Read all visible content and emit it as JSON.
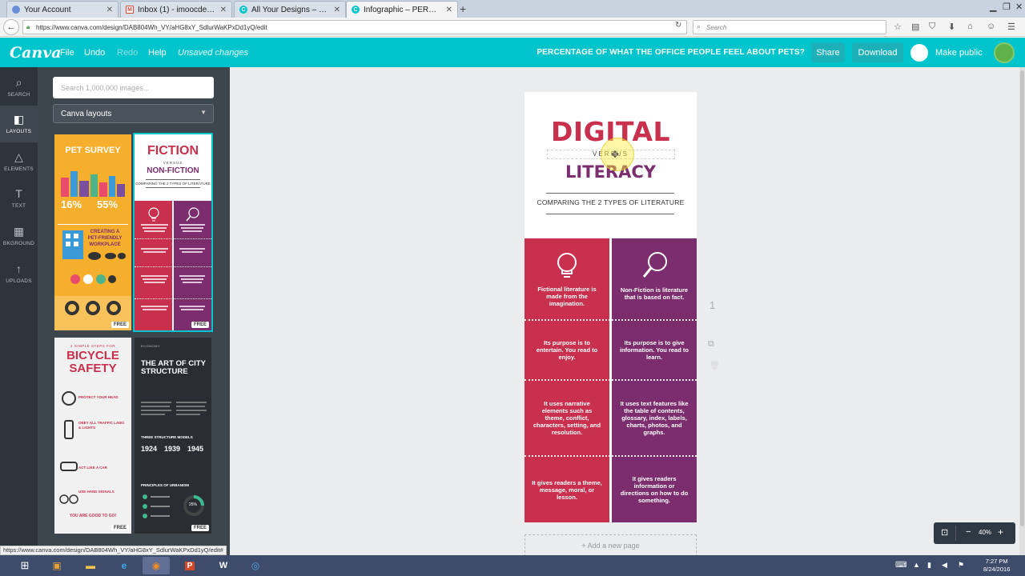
{
  "browser": {
    "tabs": [
      {
        "title": "Your Account",
        "favicon_color": "#6b8fd6"
      },
      {
        "title": "Inbox (1) - imoocdev@gm...",
        "favicon_color": "#d44638"
      },
      {
        "title": "All Your Designs – Canva",
        "favicon_color": "#00c4cc"
      },
      {
        "title": "Infographic – PERCENTAG...",
        "favicon_color": "#00c4cc"
      }
    ],
    "url": "https://www.canva.com/design/DAB804Wh_VY/aHG8xY_SdlurWaKPxDd1yQ/edit",
    "search_placeholder": "Search",
    "status_url": "https://www.canva.com/design/DAB804Wh_VY/aHG8xY_SdlurWaKPxDd1yQ/edit#"
  },
  "header": {
    "logo": "Canva",
    "menu": [
      "File",
      "Undo",
      "Redo",
      "Help"
    ],
    "unsaved": "Unsaved changes",
    "doc_title": "PERCENTAGE OF WHAT THE OFFICE PEOPLE FEEL ABOUT PETS?",
    "share": "Share",
    "download": "Download",
    "make_public": "Make public"
  },
  "tools": [
    {
      "label": "SEARCH",
      "icon": "search-icon"
    },
    {
      "label": "LAYOUTS",
      "icon": "layouts-icon"
    },
    {
      "label": "ELEMENTS",
      "icon": "elements-icon"
    },
    {
      "label": "TEXT",
      "icon": "text-icon"
    },
    {
      "label": "BKGROUND",
      "icon": "background-icon"
    },
    {
      "label": "UPLOADS",
      "icon": "upload-icon"
    }
  ],
  "panel": {
    "search_placeholder": "Search 1,000,000 images...",
    "layout_select": "Canva layouts",
    "free_badge": "FREE",
    "thumbs": {
      "pet": {
        "title": "PET SURVEY",
        "stat1": "16%",
        "stat2": "55%",
        "mid": "CREATING A PET-FRIENDLY WORKPLACE"
      },
      "fiction": {
        "title1": "FICTION",
        "versus": "VERSUS",
        "title2": "NON-FICTION",
        "sub": "COMPARING THE 2 TYPES OF LITERATURE"
      },
      "bike": {
        "top": "4 SIMPLE STEPS FOR",
        "title1": "BICYCLE",
        "title2": "SAFETY",
        "s1": "PROTECT YOUR HEAD",
        "s2": "OBEY ALL TRAFFIC LAWS & LIGHTS",
        "s3": "ACT LIKE A CAR",
        "s4": "USE HAND SIGNALS",
        "end": "YOU ARE GOOD TO GO!"
      },
      "city": {
        "kicker": "ECONOMY",
        "title": "THE ART OF CITY STRUCTURE",
        "models": "THREE STRUCTURE MODELS",
        "y1": "1924",
        "y2": "1939",
        "y3": "1945",
        "principles": "PRINCIPLES OF URBANISM",
        "pct": "25%"
      }
    }
  },
  "design": {
    "title1": "DIGITAL",
    "versus": "VERSUS",
    "title2": "LITERACY",
    "subtitle": "COMPARING THE 2 TYPES OF LITERATURE",
    "left": [
      "Fictional literature is made from the imagination.",
      "Its purpose is to entertain. You read to enjoy.",
      "It uses narrative elements such as theme, conflict, characters, setting, and resolution.",
      "It gives readers a theme, message, moral, or lesson."
    ],
    "right": [
      "Non-Fiction is literature that is based on fact.",
      "Its purpose is to give information. You read to learn.",
      "It uses text features like the table of contents, glossary, index, labels, charts, photos, and graphs.",
      "It gives readers information or directions on how to do something."
    ],
    "colors": {
      "left": "#c8304d",
      "right": "#7b2d6e"
    },
    "add_page": "+ Add a new page",
    "page_number": "1"
  },
  "zoom": {
    "minus": "−",
    "value": "40%",
    "plus": "+"
  },
  "taskbar": {
    "time": "7:27 PM",
    "date": "8/24/2016"
  }
}
